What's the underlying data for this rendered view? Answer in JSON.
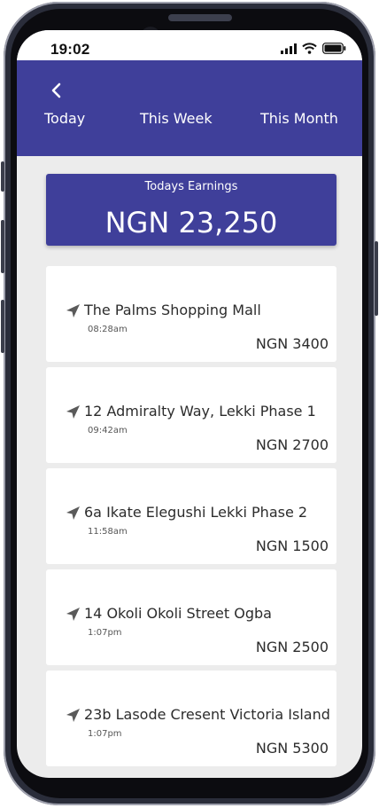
{
  "status": {
    "time": "19:02"
  },
  "tabs": [
    "Today",
    "This Week",
    "This Month"
  ],
  "earnings": {
    "label": "Todays Earnings",
    "value": "NGN 23,250"
  },
  "trips": [
    {
      "destination": "The Palms Shopping Mall",
      "time": "08:28am",
      "amount": "NGN 3400"
    },
    {
      "destination": "12 Admiralty Way, Lekki Phase 1",
      "time": "09:42am",
      "amount": "NGN 2700"
    },
    {
      "destination": "6a Ikate Elegushi Lekki Phase 2",
      "time": "11:58am",
      "amount": "NGN 1500"
    },
    {
      "destination": "14 Okoli Okoli Street Ogba",
      "time": "1:07pm",
      "amount": "NGN 2500"
    },
    {
      "destination": "23b Lasode Cresent Victoria Island",
      "time": "1:07pm",
      "amount": "NGN 5300"
    }
  ],
  "colors": {
    "primary": "#3f3f9a",
    "background": "#ececec",
    "card": "#ffffff"
  },
  "icons": {
    "back": "chevron-left-icon",
    "trip": "send-arrow-icon",
    "signal": "signal-icon",
    "wifi": "wifi-icon",
    "battery": "battery-icon"
  }
}
